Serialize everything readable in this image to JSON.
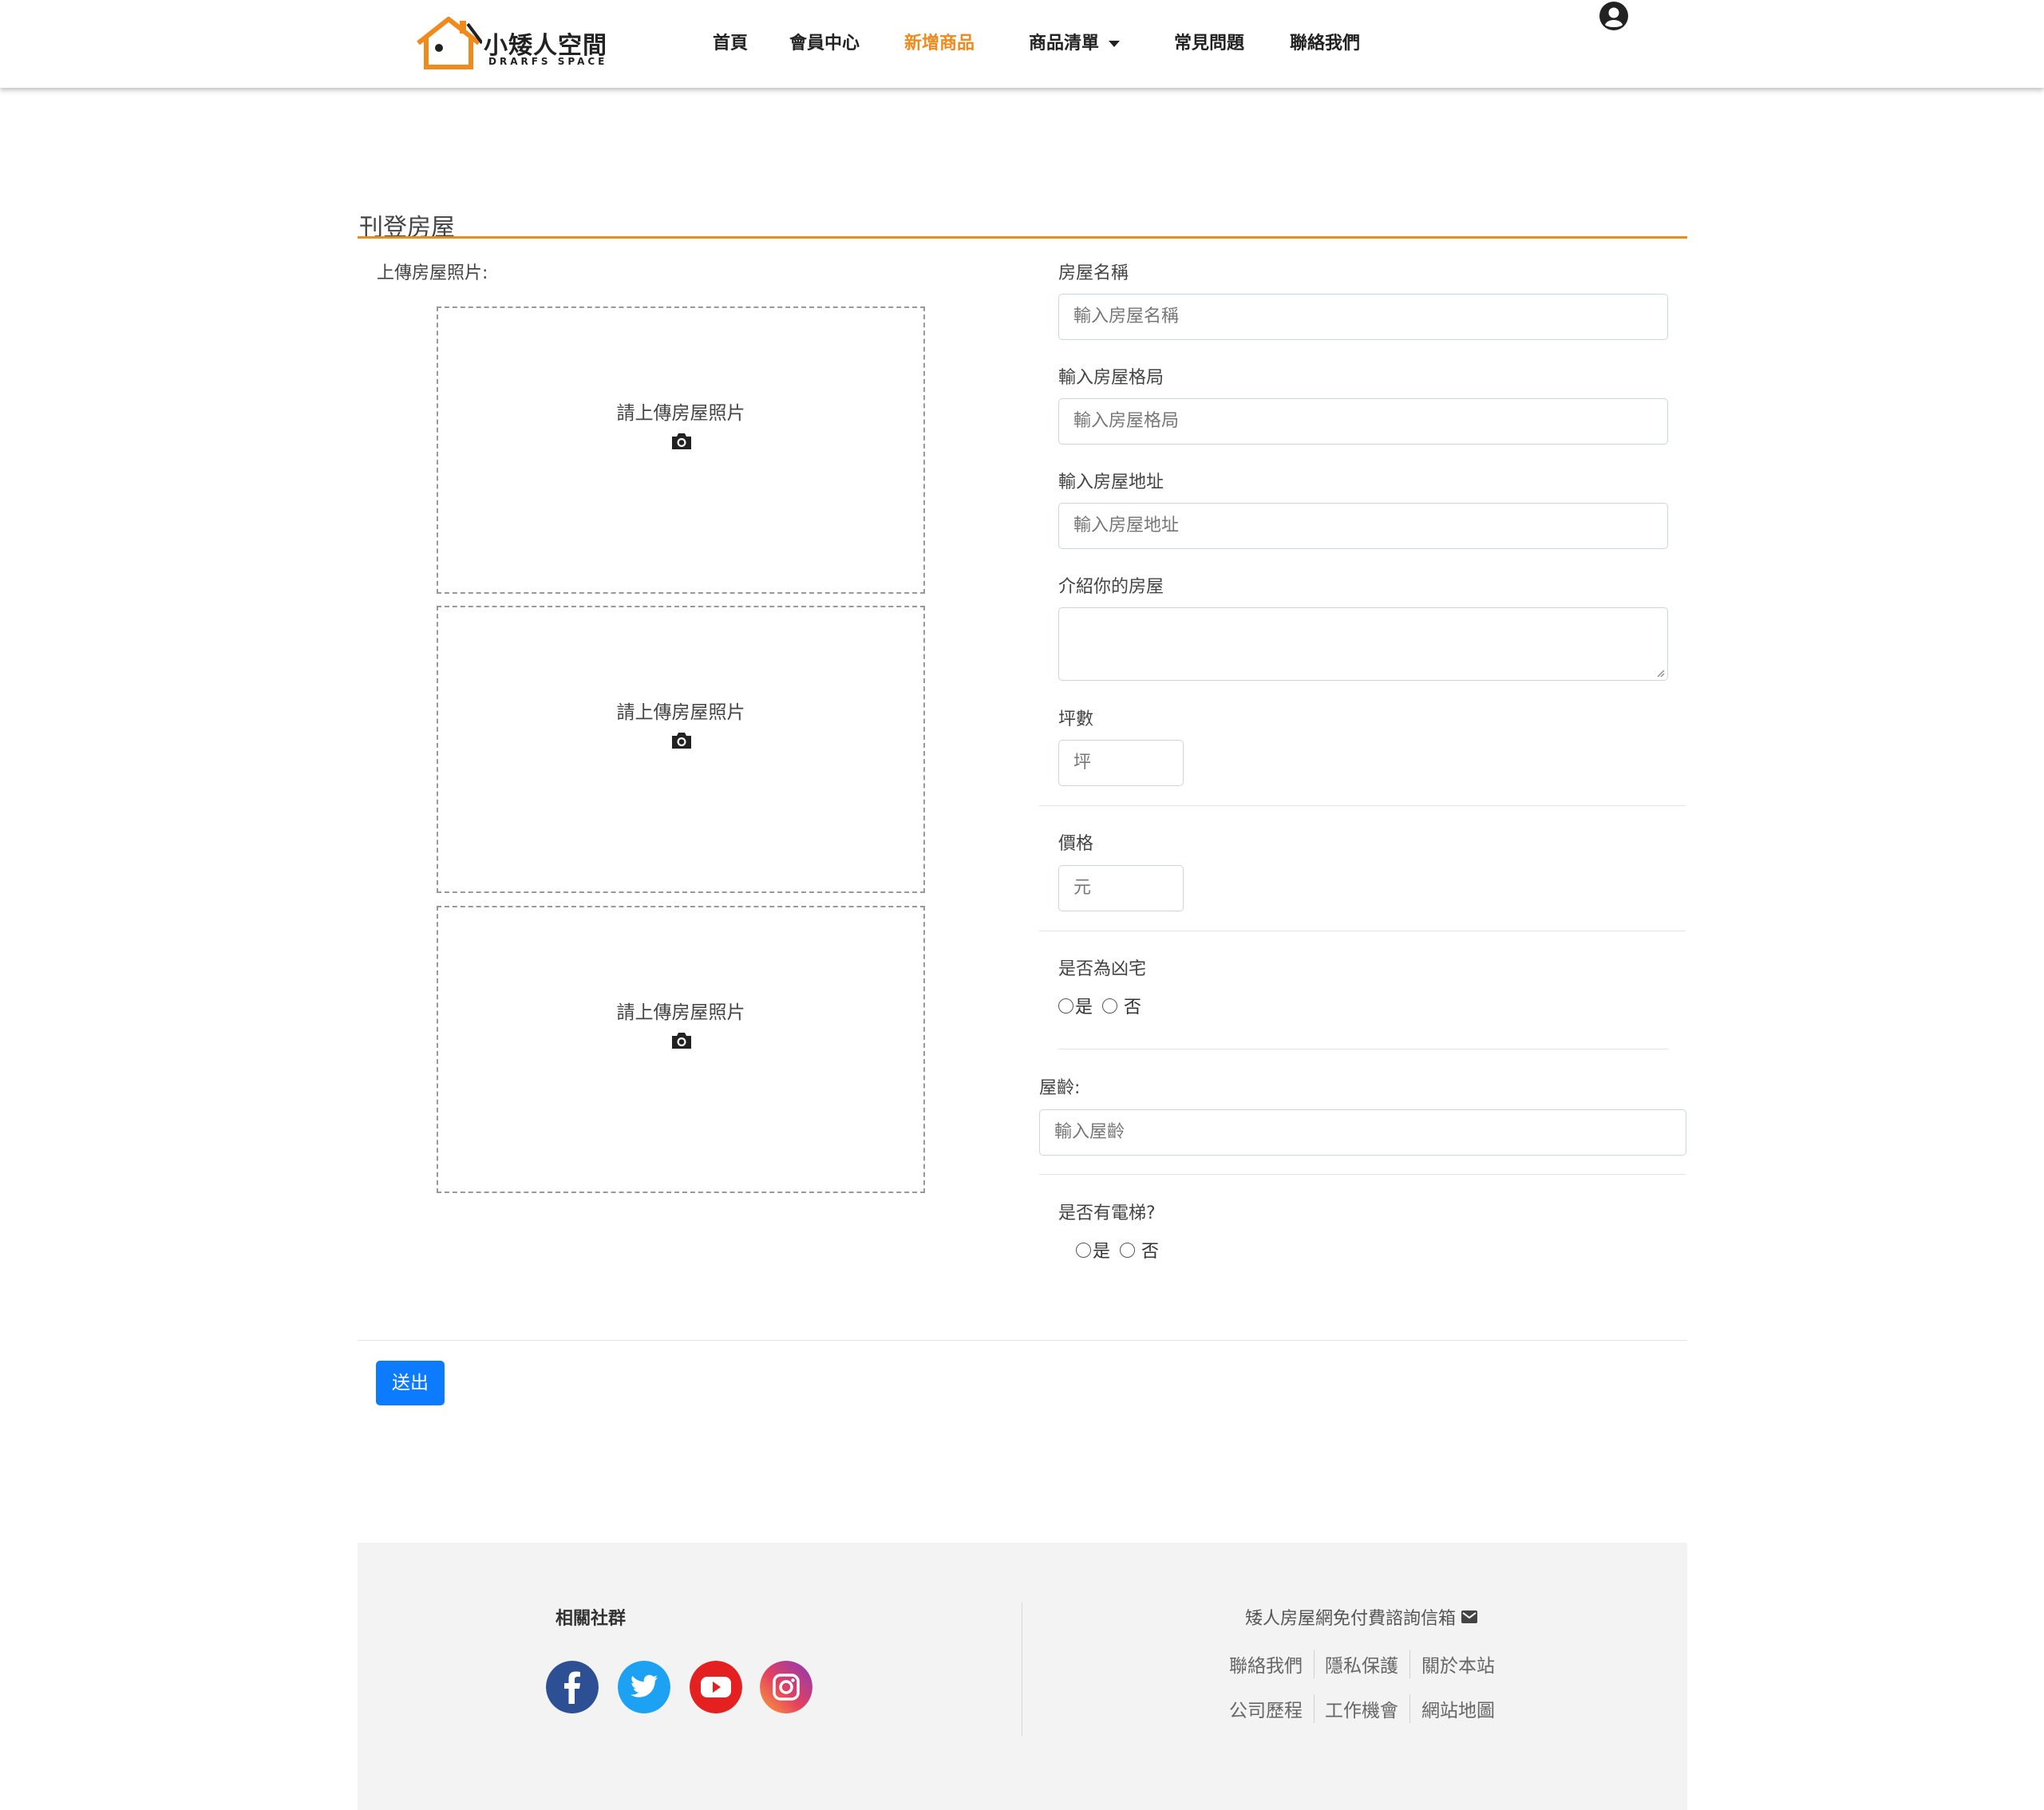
{
  "brand": {
    "name": "小矮人空間",
    "subtitle": "DRARFS SPACE",
    "color": "#f08a1c"
  },
  "nav": {
    "items": [
      {
        "label": "首頁"
      },
      {
        "label": "會員中心"
      },
      {
        "label": "新增商品",
        "active": true
      },
      {
        "label": "商品清單",
        "dropdown": true
      },
      {
        "label": "常見問題"
      },
      {
        "label": "聯絡我們"
      }
    ],
    "user_icon": "user-circle-icon"
  },
  "form": {
    "title": "刊登房屋",
    "upload_label": "上傳房屋照片:",
    "upload_boxes": [
      {
        "text": "請上傳房屋照片",
        "icon": "camera-icon"
      },
      {
        "text": "請上傳房屋照片",
        "icon": "camera-icon"
      },
      {
        "text": "請上傳房屋照片",
        "icon": "camera-icon"
      }
    ],
    "house_name": {
      "label": "房屋名稱",
      "placeholder": "輸入房屋名稱"
    },
    "layout": {
      "label": "輸入房屋格局",
      "placeholder": "輸入房屋格局"
    },
    "address": {
      "label": "輸入房屋地址",
      "placeholder": "輸入房屋地址"
    },
    "intro": {
      "label": "介紹你的房屋",
      "placeholder": ""
    },
    "area": {
      "label": "坪數",
      "placeholder": "坪"
    },
    "price": {
      "label": "價格",
      "placeholder": "元"
    },
    "haunted": {
      "label": "是否為凶宅",
      "yes": "是",
      "no": "否"
    },
    "age": {
      "label": "屋齡:",
      "placeholder": "輸入屋齡"
    },
    "elevator": {
      "label": "是否有電梯?",
      "yes": "是",
      "no": "否"
    },
    "submit": "送出",
    "submit_color": "#0d7bff"
  },
  "footer": {
    "social_title": "相關社群",
    "social_icons": [
      "facebook-icon",
      "twitter-icon",
      "youtube-icon",
      "instagram-icon"
    ],
    "mail_text": "矮人房屋網免付費諮詢信箱",
    "links_row1": [
      "聯絡我們",
      "隱私保護",
      "關於本站"
    ],
    "links_row2": [
      "公司歷程",
      "工作機會",
      "網站地圖"
    ]
  }
}
